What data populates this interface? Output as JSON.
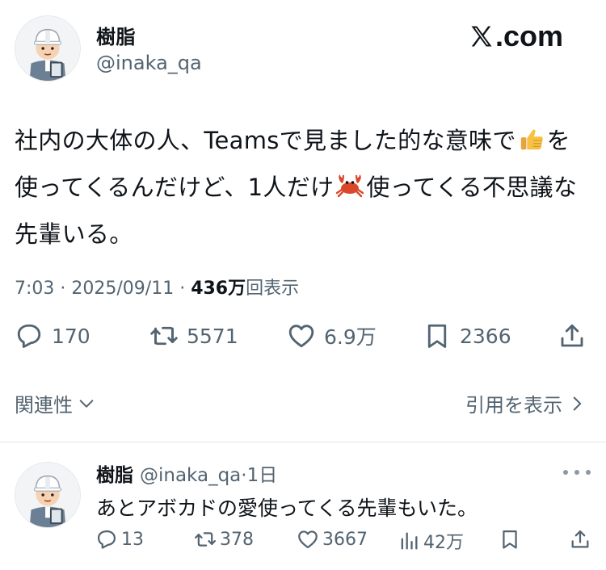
{
  "brand": {
    "text": ".com",
    "icon": "x-logo-icon"
  },
  "author": {
    "display_name": "樹脂",
    "handle": "@inaka_qa",
    "avatar": "construction-worker-avatar"
  },
  "tweet": {
    "text_part1": "社内の大体の人、Teamsで見ました的な意味で",
    "emoji1": "thumbs-up-emoji",
    "text_part2": "を使ってくるんだけど、1人だけ",
    "emoji2": "crab-emoji",
    "text_part3": "使ってくる不思議な先輩いる。",
    "time": "7:03",
    "sep": " · ",
    "date": "2025/09/11",
    "views_count": "436万",
    "views_label": "回表示"
  },
  "actions": {
    "replies": "170",
    "retweets": "5571",
    "likes": "6.9万",
    "bookmarks": "2366"
  },
  "links": {
    "related": "関連性",
    "quotes": "引用を表示"
  },
  "reply": {
    "display_name": "樹脂",
    "handle": "@inaka_qa",
    "dot": "·",
    "time": "1日",
    "text": "あとアボカドの愛使ってくる先輩もいた。",
    "replies": "13",
    "retweets": "378",
    "likes": "3667",
    "views": "42万"
  },
  "colors": {
    "text": "#0f1419",
    "secondary": "#536471",
    "divider": "#e1e6ea",
    "helmet": "#ffffff",
    "uniform": "#6b7f95"
  }
}
